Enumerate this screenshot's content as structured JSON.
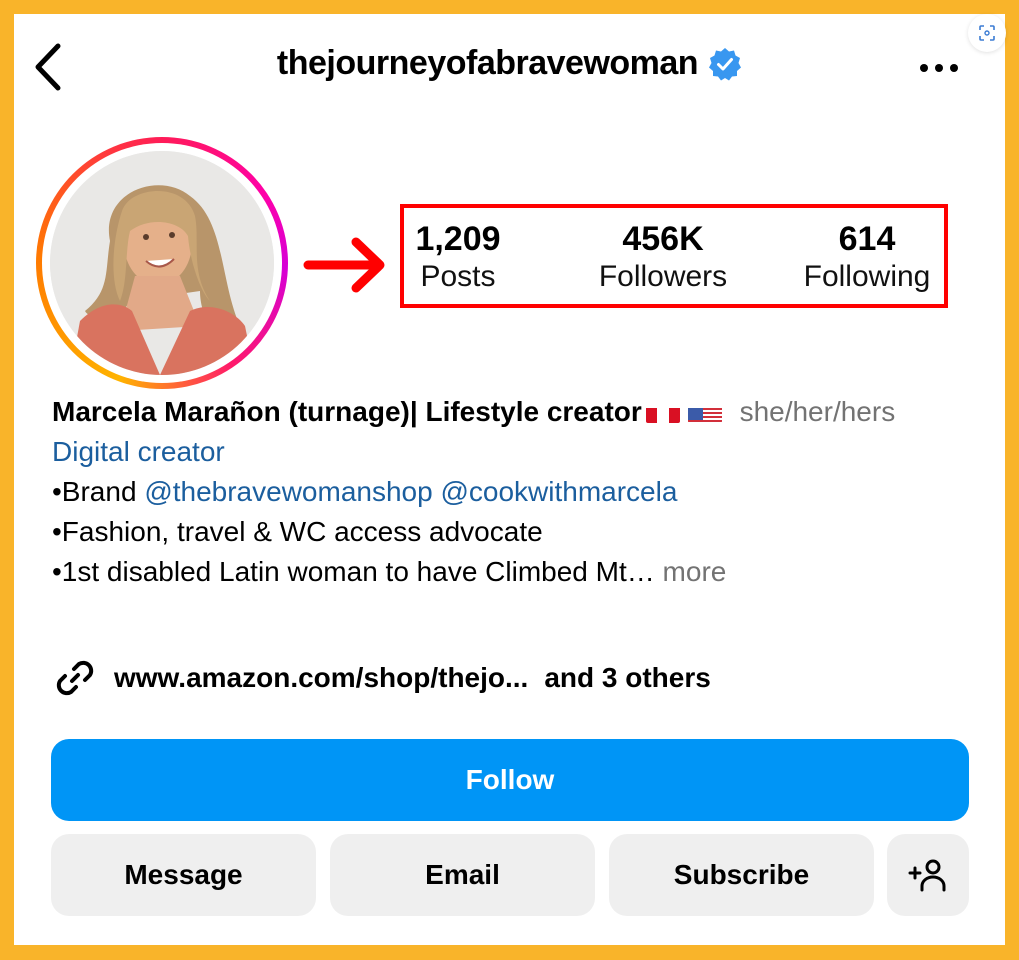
{
  "header": {
    "username": "thejourneyofabravewoman",
    "verified": true,
    "back_icon": "chevron-left-icon",
    "more_icon": "more-horizontal-icon",
    "scan_icon": "scan-icon"
  },
  "profile": {
    "avatar_alt": "Profile photo",
    "story_ring": true
  },
  "annotation": {
    "arrow_color": "#FF0000",
    "box_color": "#FF0000"
  },
  "stats": [
    {
      "value": "1,209",
      "label": "Posts"
    },
    {
      "value": "456K",
      "label": "Followers"
    },
    {
      "value": "614",
      "label": "Following"
    }
  ],
  "bio": {
    "name": "Marcela Marañon (turnage)| Lifestyle creator",
    "flags": [
      "Peru flag",
      "US flag"
    ],
    "pronouns": "she/her/hers",
    "category": "Digital creator",
    "line1_prefix": "•Brand ",
    "mention1": "@thebravewomanshop",
    "mention2": "@cookwithmarcela",
    "line2": "•Fashion, travel & WC access advocate",
    "line3": "•1st disabled Latin woman to have Climbed Mt…",
    "more_label": "more"
  },
  "links": {
    "url": "www.amazon.com/shop/thejo...",
    "others": "and 3 others"
  },
  "buttons": {
    "follow": "Follow",
    "message": "Message",
    "email": "Email",
    "subscribe": "Subscribe",
    "suggest_icon": "add-person-icon"
  },
  "colors": {
    "frame": "#F9B42A",
    "follow_bg": "#0095F6",
    "secondary_bg": "#EFEFEF",
    "link_blue": "#1B5E9E",
    "verified_blue": "#3897F0"
  }
}
